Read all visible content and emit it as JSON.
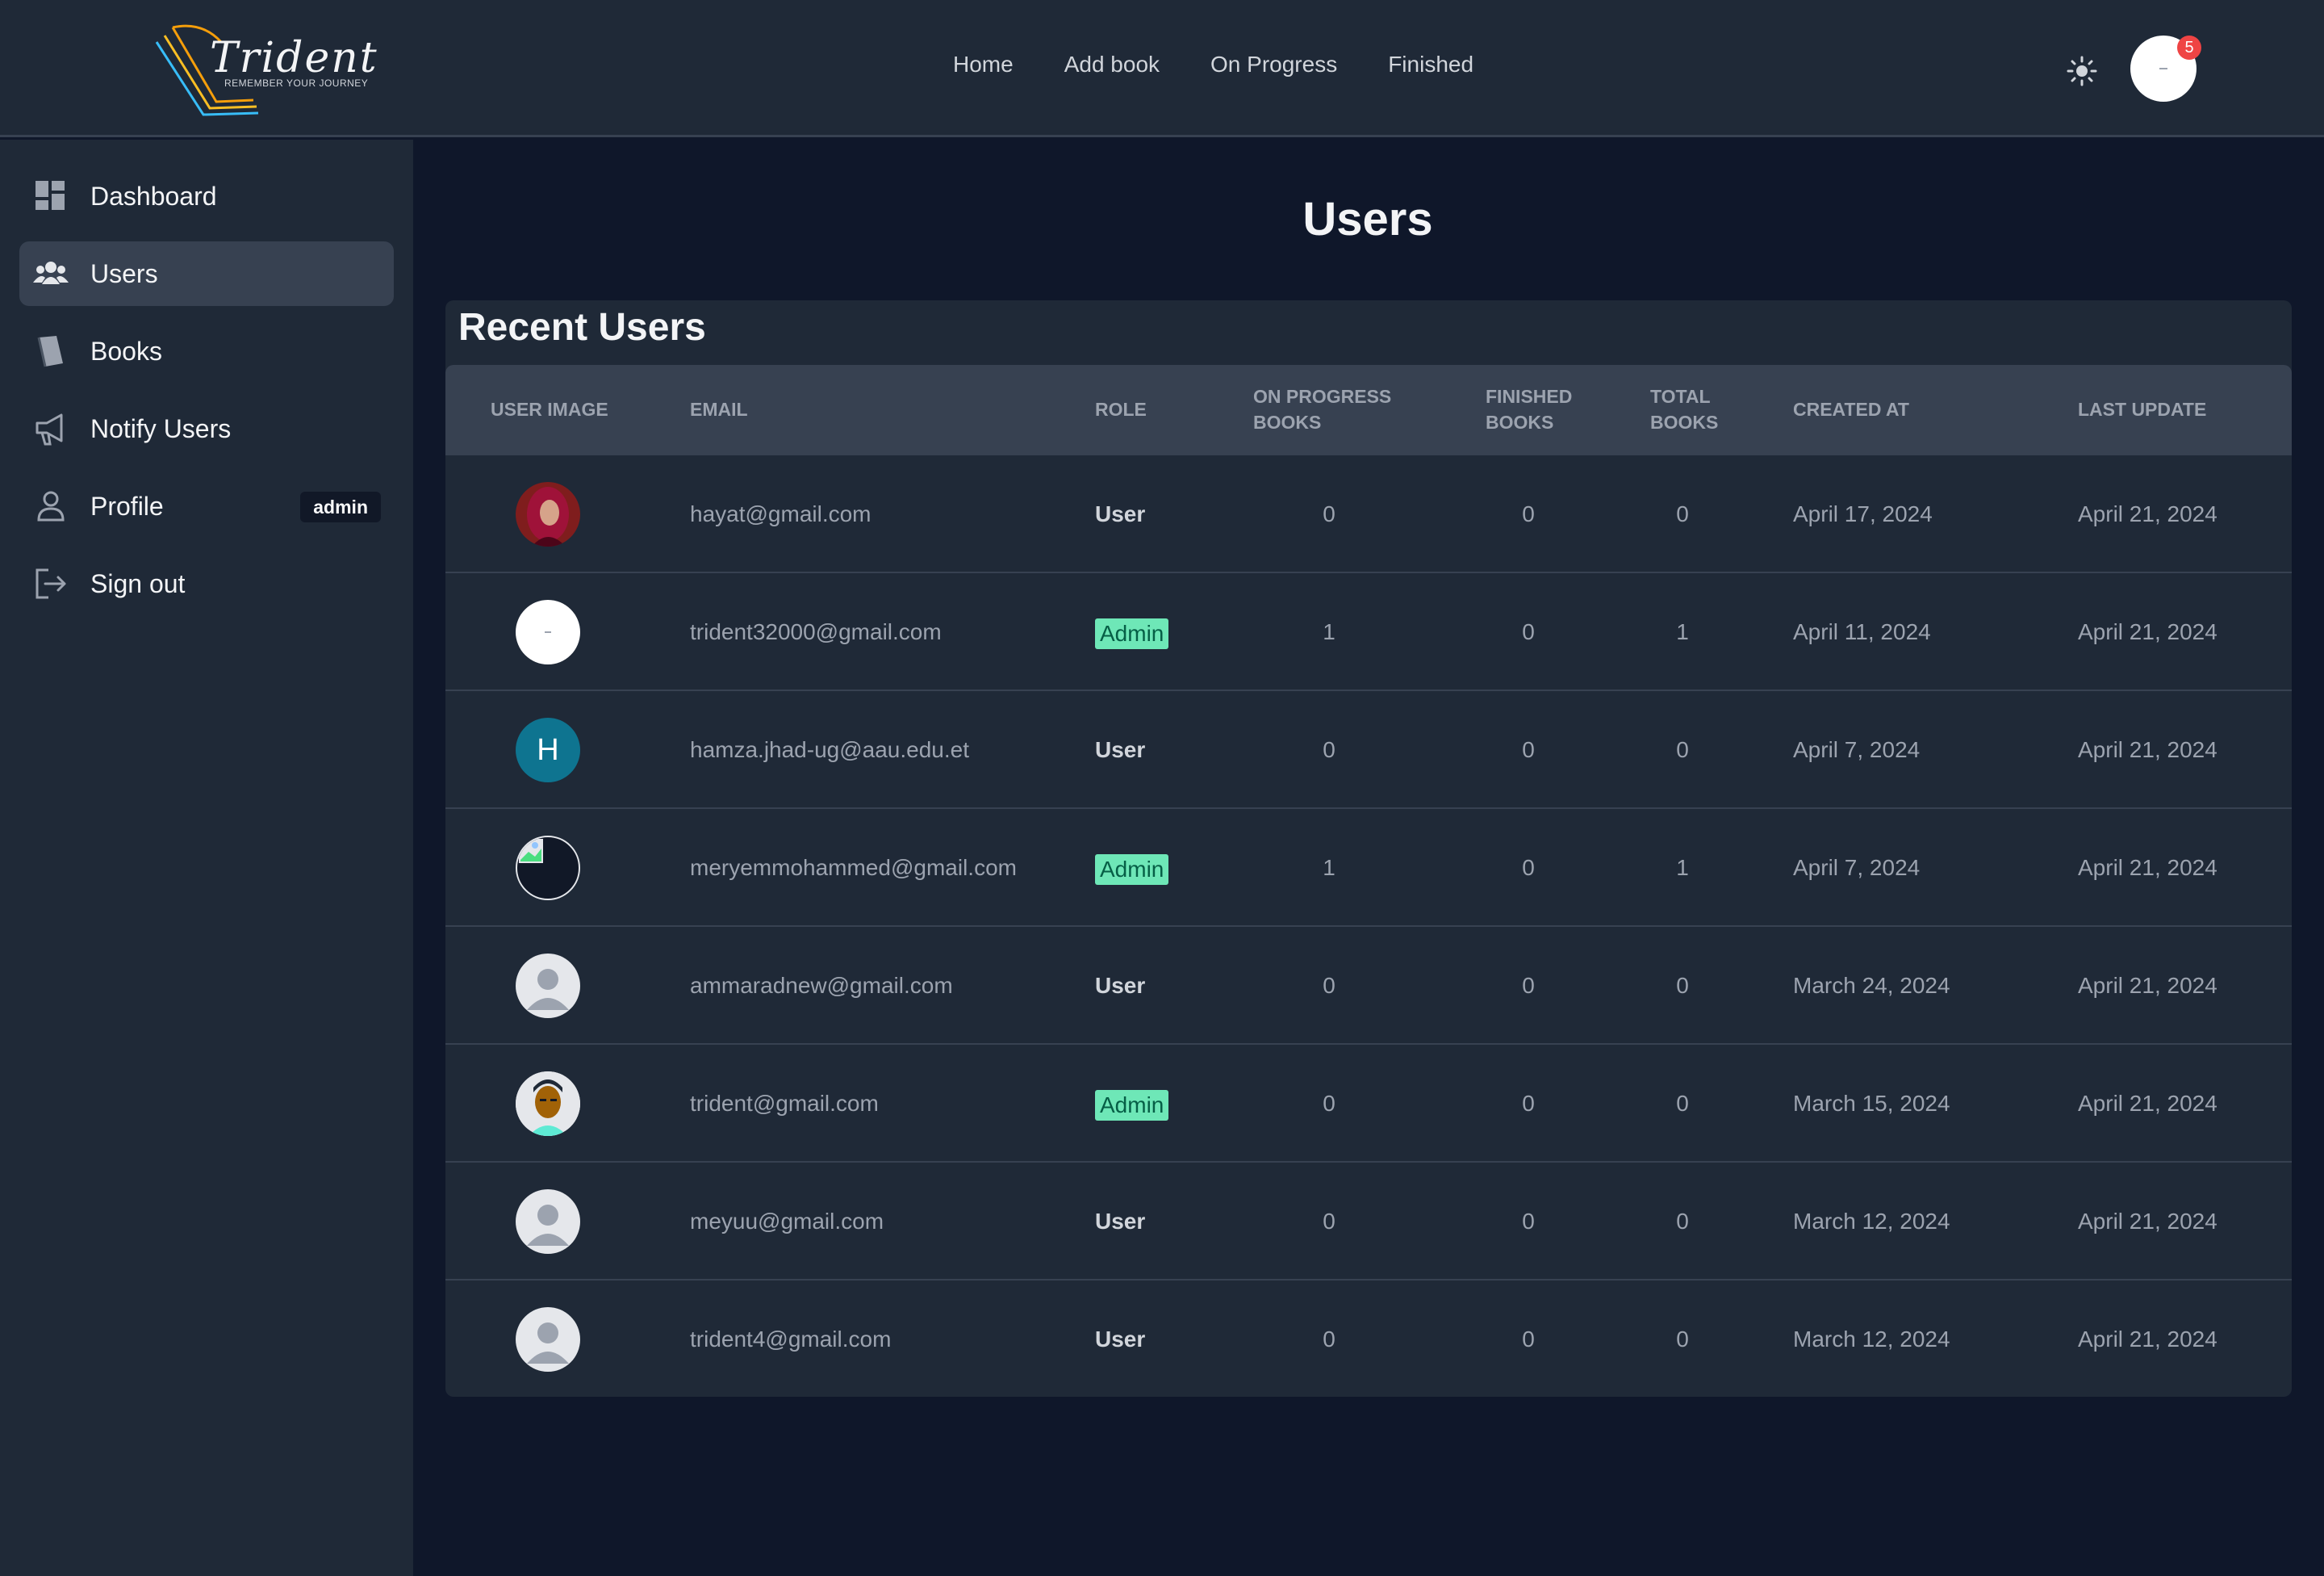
{
  "brand": {
    "logo_title": "Trident",
    "logo_tagline": "REMEMBER YOUR JOURNEY"
  },
  "nav": {
    "home": "Home",
    "add_book": "Add book",
    "on_progress": "On Progress",
    "finished": "Finished"
  },
  "header": {
    "theme_icon": "sun-icon",
    "notification_count": "5"
  },
  "sidebar": {
    "items": [
      {
        "label": "Dashboard",
        "icon": "dashboard-icon"
      },
      {
        "label": "Users",
        "icon": "users-icon",
        "active": true
      },
      {
        "label": "Books",
        "icon": "book-icon"
      },
      {
        "label": "Notify Users",
        "icon": "megaphone-icon"
      },
      {
        "label": "Profile",
        "icon": "user-icon",
        "badge": "admin"
      },
      {
        "label": "Sign out",
        "icon": "sign-out-icon"
      }
    ]
  },
  "page": {
    "title": "Users"
  },
  "table": {
    "title": "Recent Users",
    "headers": {
      "user_image": "USER IMAGE",
      "email": "EMAIL",
      "role": "ROLE",
      "on_progress_1": "ON PROGRESS",
      "on_progress_2": "BOOKS",
      "finished_1": "FINISHED",
      "finished_2": "BOOKS",
      "total_1": "TOTAL",
      "total_2": "BOOKS",
      "created_at": "CREATED AT",
      "last_update": "LAST UPDATE"
    },
    "rows": [
      {
        "email": "hayat@gmail.com",
        "role": "User",
        "on_progress": "0",
        "finished": "0",
        "total": "0",
        "created_at": "April 17, 2024",
        "last_update": "April 21, 2024",
        "avatar": "photo-hijab"
      },
      {
        "email": "trident32000@gmail.com",
        "role": "Admin",
        "on_progress": "1",
        "finished": "0",
        "total": "1",
        "created_at": "April 11, 2024",
        "last_update": "April 21, 2024",
        "avatar": "white-blank"
      },
      {
        "email": "hamza.jhad-ug@aau.edu.et",
        "role": "User",
        "on_progress": "0",
        "finished": "0",
        "total": "0",
        "created_at": "April 7, 2024",
        "last_update": "April 21, 2024",
        "avatar": "letter-h",
        "avatar_letter": "H"
      },
      {
        "email": "meryemmohammed@gmail.com",
        "role": "Admin",
        "on_progress": "1",
        "finished": "0",
        "total": "1",
        "created_at": "April 7, 2024",
        "last_update": "April 21, 2024",
        "avatar": "broken-image"
      },
      {
        "email": "ammaradnew@gmail.com",
        "role": "User",
        "on_progress": "0",
        "finished": "0",
        "total": "0",
        "created_at": "March 24, 2024",
        "last_update": "April 21, 2024",
        "avatar": "default-person"
      },
      {
        "email": "trident@gmail.com",
        "role": "Admin",
        "on_progress": "0",
        "finished": "0",
        "total": "0",
        "created_at": "March 15, 2024",
        "last_update": "April 21, 2024",
        "avatar": "illustration-man"
      },
      {
        "email": "meyuu@gmail.com",
        "role": "User",
        "on_progress": "0",
        "finished": "0",
        "total": "0",
        "created_at": "March 12, 2024",
        "last_update": "April 21, 2024",
        "avatar": "default-person"
      },
      {
        "email": "trident4@gmail.com",
        "role": "User",
        "on_progress": "0",
        "finished": "0",
        "total": "0",
        "created_at": "March 12, 2024",
        "last_update": "April 21, 2024",
        "avatar": "default-person"
      }
    ]
  },
  "colors": {
    "page_bg": "#0f172a",
    "panel_bg": "#1f2937",
    "header_row_bg": "#374151",
    "admin_badge_bg": "#6ee7b7",
    "admin_badge_text": "#065f46",
    "notification_badge": "#ef4444",
    "avatar_teal": "#0e7490"
  }
}
